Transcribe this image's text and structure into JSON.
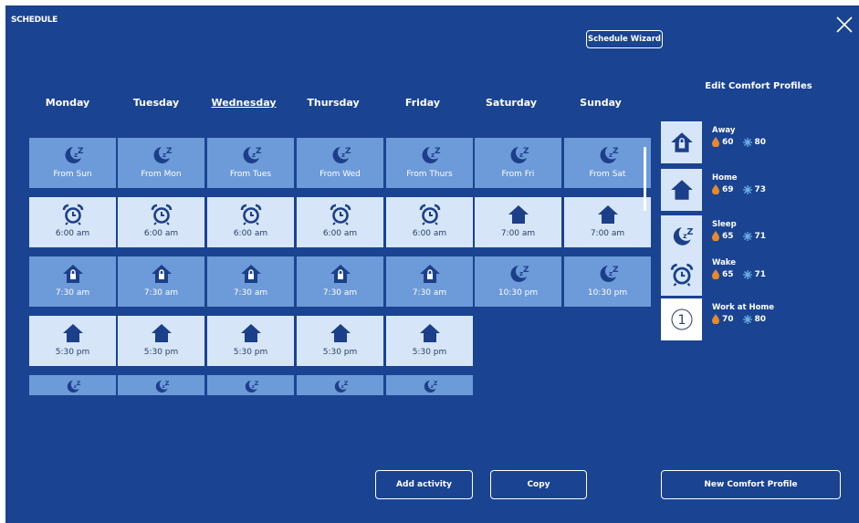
{
  "header": {
    "title": "SCHEDULE",
    "wizard_label": "Schedule Wizard"
  },
  "days": [
    "Monday",
    "Tuesday",
    "Wednesday",
    "Thursday",
    "Friday",
    "Saturday",
    "Sunday"
  ],
  "selected_day": "Wednesday",
  "schedule": {
    "row1": [
      "From Sun",
      "From Mon",
      "From Tues",
      "From Wed",
      "From Thurs",
      "From Fri",
      "From Sat"
    ],
    "row2": [
      "6:00 am",
      "6:00 am",
      "6:00 am",
      "6:00 am",
      "6:00 am",
      "7:00 am",
      "7:00 am"
    ],
    "row3": [
      "7:30 am",
      "7:30 am",
      "7:30 am",
      "7:30 am",
      "7:30 am",
      "10:30 pm",
      "10:30 pm"
    ],
    "row4": [
      "5:30 pm",
      "5:30 pm",
      "5:30 pm",
      "5:30 pm",
      "5:30 pm"
    ]
  },
  "profiles_title": "Edit Comfort Profiles",
  "profiles": [
    {
      "name": "Away",
      "heat": "60",
      "cool": "80",
      "icon": "lock-house-icon"
    },
    {
      "name": "Home",
      "heat": "69",
      "cool": "73",
      "icon": "house-icon"
    },
    {
      "name": "Sleep",
      "heat": "65",
      "cool": "71",
      "icon": "moon-icon"
    },
    {
      "name": "Wake",
      "heat": "65",
      "cool": "71",
      "icon": "alarm-clock-icon"
    },
    {
      "name": "Work at Home",
      "heat": "70",
      "cool": "80",
      "icon": "number-one-circle-icon",
      "badge": "1"
    }
  ],
  "buttons": {
    "add": "Add activity",
    "copy": "Copy",
    "new_profile": "New Comfort Profile"
  },
  "colors": {
    "background": "#1a4391",
    "tile_mid": "#6d9ad8",
    "tile_light": "#d6e6f8",
    "icon": "#1c3f8a",
    "flame": "#e8892a",
    "snow": "#6ab0e8"
  }
}
